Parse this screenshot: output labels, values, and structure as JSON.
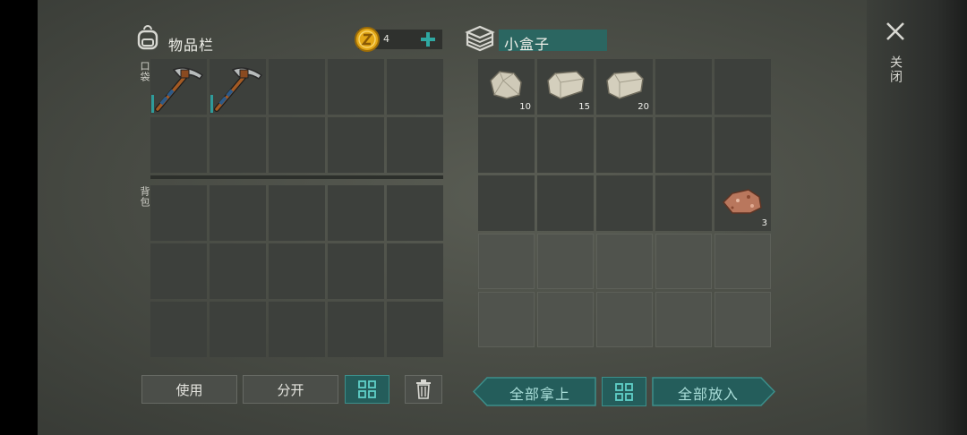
{
  "inventory": {
    "title": "物品栏",
    "coins": "4",
    "pocket_label": "口袋",
    "backpack_label": "背包",
    "pocket_slots": [
      {
        "item": "pickaxe-icon",
        "count": ""
      },
      {
        "item": "pickaxe-icon",
        "count": ""
      },
      {
        "item": "",
        "count": ""
      },
      {
        "item": "",
        "count": ""
      },
      {
        "item": "",
        "count": ""
      },
      {
        "item": "",
        "count": ""
      },
      {
        "item": "",
        "count": ""
      },
      {
        "item": "",
        "count": ""
      },
      {
        "item": "",
        "count": ""
      },
      {
        "item": "",
        "count": ""
      }
    ],
    "use_label": "使用",
    "split_label": "分开"
  },
  "container": {
    "title": "小盒子",
    "slots": [
      {
        "item": "stone-icon",
        "count": "10"
      },
      {
        "item": "stone-icon",
        "count": "15"
      },
      {
        "item": "stone-icon",
        "count": "20"
      },
      {
        "item": "",
        "count": ""
      },
      {
        "item": "",
        "count": ""
      },
      {
        "item": "",
        "count": ""
      },
      {
        "item": "",
        "count": ""
      },
      {
        "item": "",
        "count": ""
      },
      {
        "item": "",
        "count": ""
      },
      {
        "item": "",
        "count": ""
      },
      {
        "item": "",
        "count": ""
      },
      {
        "item": "",
        "count": ""
      },
      {
        "item": "",
        "count": ""
      },
      {
        "item": "",
        "count": ""
      },
      {
        "item": "copper-ore-icon",
        "count": "3"
      }
    ],
    "take_all_label": "全部拿上",
    "put_all_label": "全部放入"
  },
  "close_label": "关闭",
  "colors": {
    "accent": "#2f9b9a",
    "coin": "#e3a716",
    "container_title_bg": "#2b6661"
  }
}
